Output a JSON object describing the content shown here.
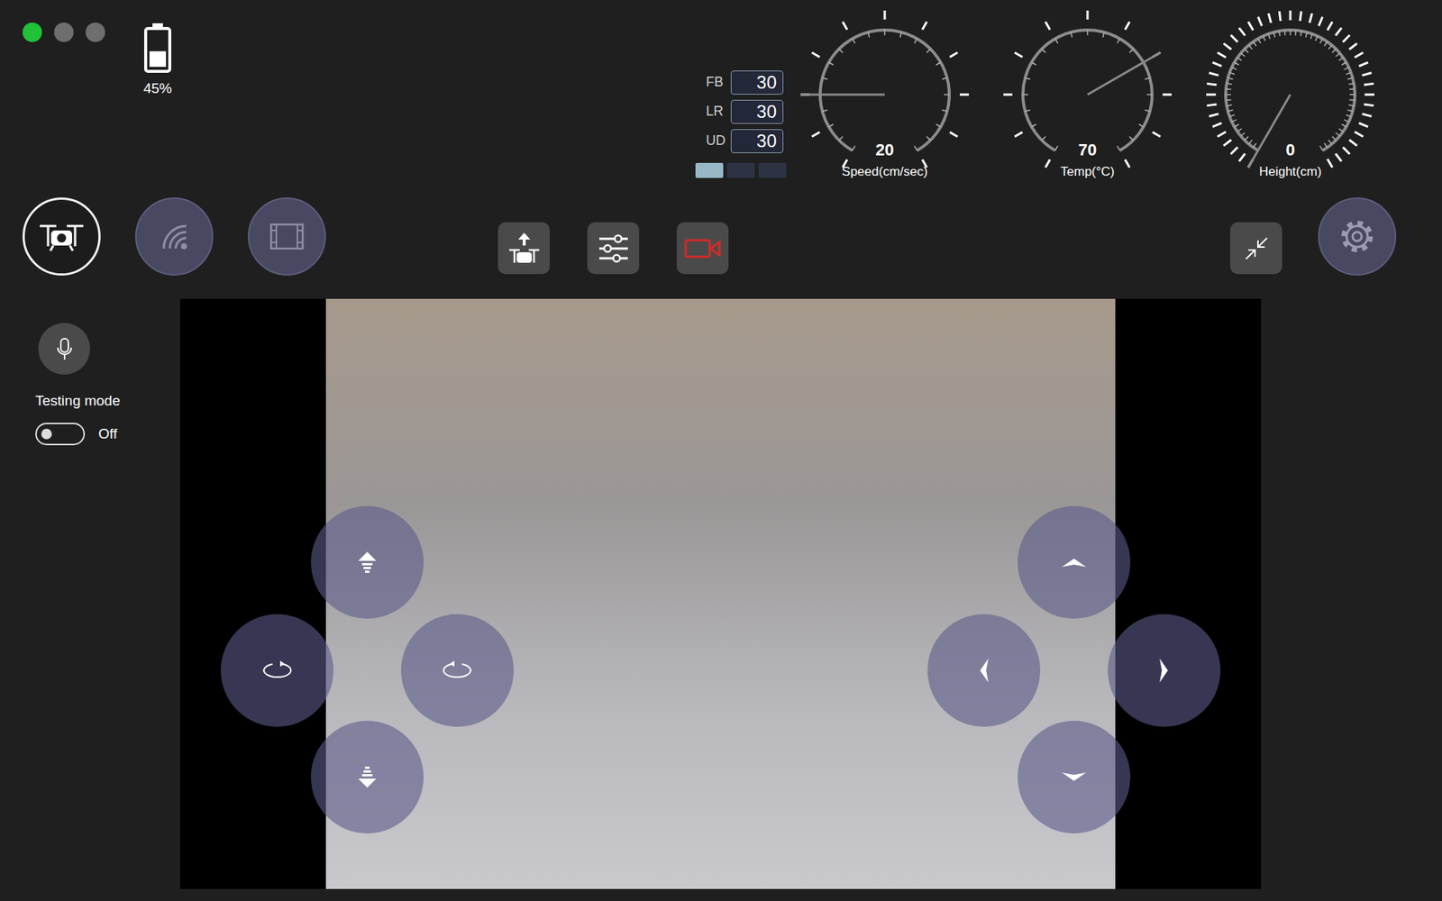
{
  "status_dots": [
    {
      "color": "#21c13a"
    },
    {
      "color": "#6e6e6e"
    },
    {
      "color": "#6e6e6e"
    }
  ],
  "battery": {
    "level": 0.45,
    "reading": "45%"
  },
  "speed_settings": [
    {
      "label": "FB",
      "value": "30"
    },
    {
      "label": "LR",
      "value": "30"
    },
    {
      "label": "UD",
      "value": "30"
    }
  ],
  "speed_presets": [
    {
      "selected": true
    },
    {
      "selected": false
    },
    {
      "selected": false
    }
  ],
  "gauges": [
    {
      "value": "20",
      "label": "Speed(cm/sec)",
      "level": 0.2,
      "kind": "coarse"
    },
    {
      "value": "70",
      "label": "Temp(°C)",
      "level": 0.7,
      "kind": "coarse"
    },
    {
      "value": "0",
      "label": "Height(cm)",
      "level": 0,
      "kind": "fine"
    }
  ],
  "modes": [
    {
      "kind": "drone",
      "selected": true
    },
    {
      "kind": "signal",
      "selected": false
    },
    {
      "kind": "video",
      "selected": false
    }
  ],
  "sidebar": {
    "testing_mode": {
      "label": "Testing mode",
      "on": false,
      "state_label": "Off"
    }
  }
}
